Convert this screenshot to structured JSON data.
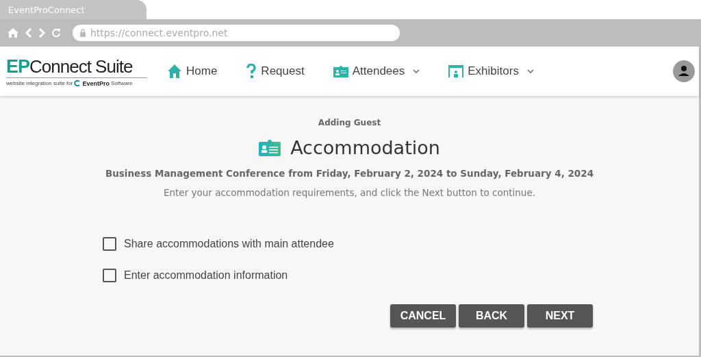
{
  "browser": {
    "tab_title": "EventProConnect",
    "url": "https://connect.eventpro.net"
  },
  "logo": {
    "mark": "EP",
    "name": "Connect Suite",
    "tagline": "website integration suite for",
    "partner": "EventPro",
    "partner_suffix": "Software"
  },
  "nav": [
    {
      "label": "Home",
      "kind": "home",
      "dropdown": false
    },
    {
      "label": "Request",
      "kind": "question",
      "dropdown": false
    },
    {
      "label": "Attendees",
      "kind": "badge",
      "dropdown": true
    },
    {
      "label": "Exhibitors",
      "kind": "booth",
      "dropdown": true
    }
  ],
  "page": {
    "subtitle": "Adding Guest",
    "title": "Accommodation",
    "event": "Business Management Conference from Friday, February 2, 2024 to Sunday, February 4, 2024",
    "instructions": "Enter your accommodation requirements, and click the Next button to continue."
  },
  "options": [
    {
      "label": "Share accommodations with main attendee",
      "checked": false
    },
    {
      "label": "Enter accommodation information",
      "checked": false
    }
  ],
  "buttons": [
    "CANCEL",
    "BACK",
    "NEXT"
  ]
}
